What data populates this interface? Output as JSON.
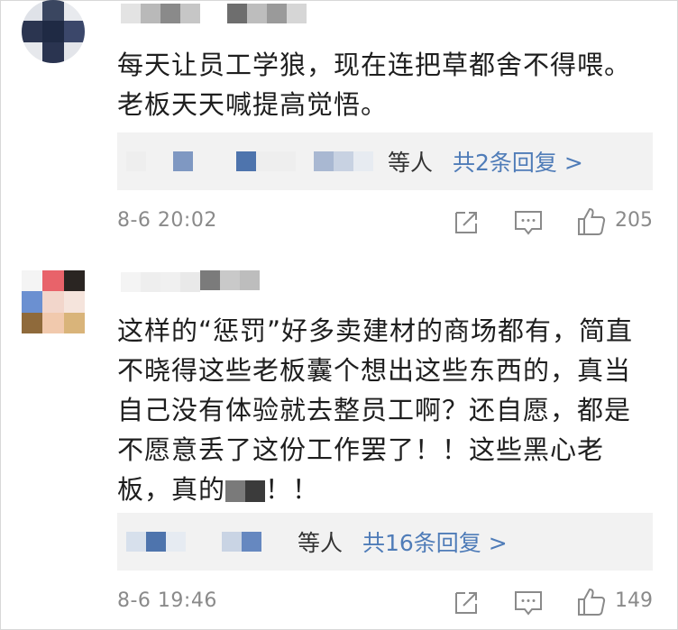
{
  "comments": [
    {
      "text_lines": [
        "每天让员工学狼，现在连把草都舍不得喂。",
        "老板天天喊提高觉悟。"
      ],
      "replies_people": "等人",
      "replies_link": "共2条回复 >",
      "time": "8-6 20:02",
      "likes": "205"
    },
    {
      "text_lines": [
        "这样的“惩罚”好多卖建材的商场都有，简直",
        "不晓得这些老板囊个想出这些东西的，真当",
        "自己没有体验就去整员工啊？还自愿，都是",
        "不愿意丢了这份工作罢了！！这些黑心老"
      ],
      "text_last_prefix": "板，真的",
      "text_last_suffix": "！！",
      "replies_people": "等人",
      "replies_link": "共16条回复 >",
      "time": "8-6 19:46",
      "likes": "149"
    }
  ],
  "icons": {
    "share": "share-icon",
    "comment": "comment-icon",
    "like": "thumbs-up-icon"
  },
  "colors": {
    "link": "#4f7cb8",
    "meta": "#8a8a8a",
    "reply_bg": "#f2f2f2"
  }
}
